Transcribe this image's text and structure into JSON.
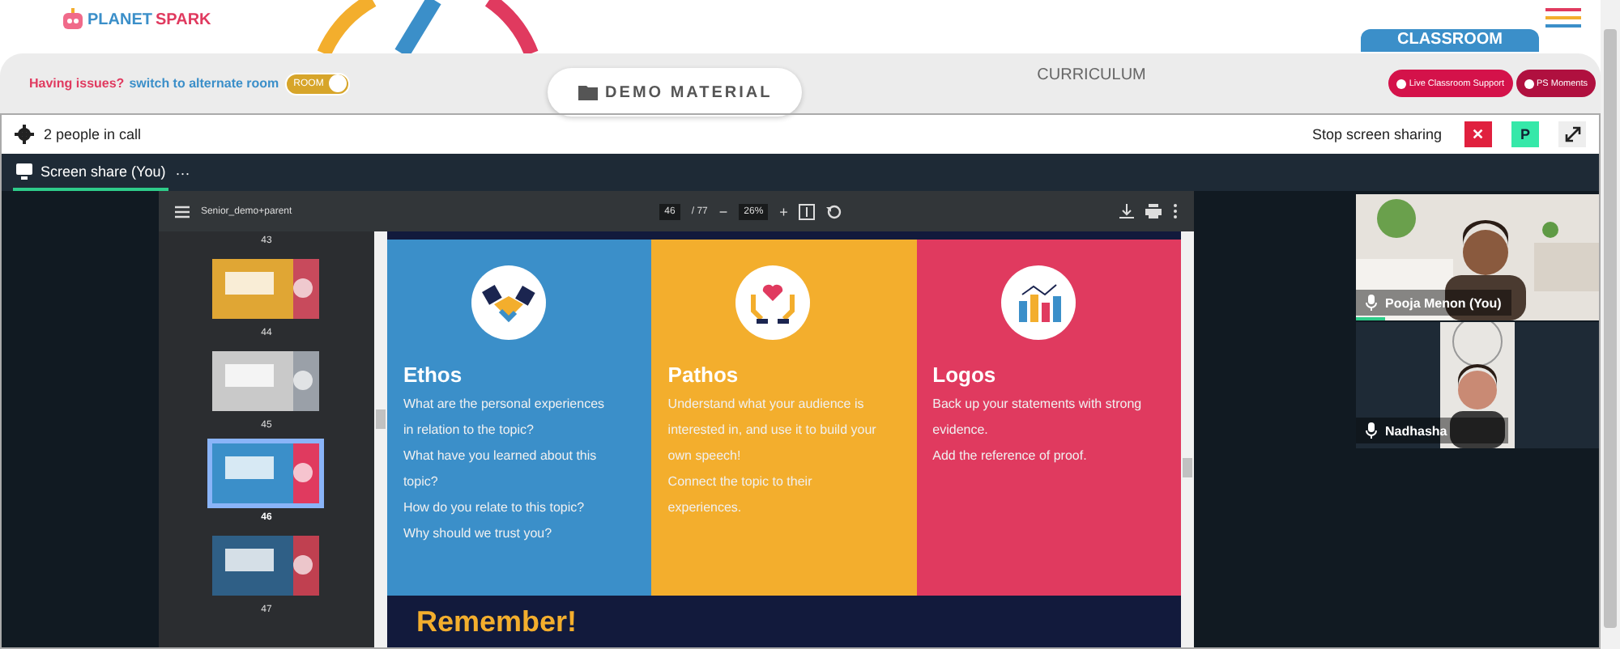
{
  "header": {
    "logo": {
      "part_1": "PLANET",
      "part_2": "SPARK"
    },
    "classroom_tab": "CLASSROOM"
  },
  "room_bar": {
    "issue_text": "Having issues?",
    "switch_link": "switch to alternate room",
    "toggle": {
      "label": "ROOM",
      "on": true
    },
    "demo_button": "DEMO MATERIAL",
    "curriculum": "CURRICULUM",
    "buttons": [
      {
        "label": "Live Classroom Support",
        "color": "#d4124a"
      },
      {
        "label": "PS Moments",
        "color": "#b0103f"
      }
    ]
  },
  "call": {
    "people_count": "2 people in call",
    "stop_sharing": "Stop screen sharing",
    "stop_button": "✕",
    "presenter_button": "P",
    "tab": {
      "label": "Screen share (You)",
      "more": "···",
      "selected": true
    }
  },
  "pdf_viewer": {
    "file_name": "Senior_demo+parent",
    "page": "46",
    "total": "/ 77",
    "zoom_out": "−",
    "zoom": "26%",
    "zoom_in": "+",
    "thumbnails": [
      {
        "label": "43",
        "kind": "label",
        "selected": false
      },
      {
        "label": "44",
        "kind": "page",
        "selected": false
      },
      {
        "label": "45",
        "kind": "page",
        "selected": false
      },
      {
        "label": "46",
        "kind": "page",
        "selected": true
      },
      {
        "label": "47",
        "kind": "page",
        "selected": false
      }
    ],
    "slide": {
      "columns": [
        {
          "title": "Ethos",
          "color": "#3b8fc9",
          "lines": [
            "What are the personal experiences in relation to the topic?",
            "What have you learned about this topic?",
            "How do you relate to this topic?",
            "Why should we trust you?"
          ]
        },
        {
          "title": "Pathos",
          "color": "#f3ae2d",
          "lines": [
            "Understand what your audience is interested in, and use it to build your own speech!",
            "Connect the topic to their experiences."
          ]
        },
        {
          "title": "Logos",
          "color": "#e03a5f",
          "lines": [
            "Back up your statements with strong evidence.",
            "Add the reference of proof."
          ]
        }
      ],
      "footer_title": "Remember!"
    }
  },
  "participants": [
    {
      "name": "Pooja Menon (You)",
      "speaking": true
    },
    {
      "name": "Nadhasha",
      "speaking": false
    }
  ]
}
